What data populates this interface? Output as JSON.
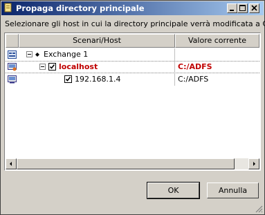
{
  "window": {
    "title": "Propaga directory principale"
  },
  "instruction": "Selezionare gli host in cui la directory principale verrà modificata a C:/",
  "columns": [
    "Scenari/Host",
    "Valore corrente"
  ],
  "rows": [
    {
      "label": "Exchange 1",
      "value": "",
      "level": 0,
      "checked": false,
      "bold_red": false
    },
    {
      "label": "localhost",
      "value": "C:/ADFS",
      "level": 1,
      "checked": true,
      "bold_red": true
    },
    {
      "label": "192.168.1.4",
      "value": "C:/ADFS",
      "level": 2,
      "checked": true,
      "bold_red": false
    }
  ],
  "buttons": {
    "ok": "OK",
    "cancel": "Annulla"
  },
  "colors": {
    "titlebar_start": "#0a246a",
    "titlebar_end": "#a6caf0",
    "highlight": "#c00000"
  }
}
